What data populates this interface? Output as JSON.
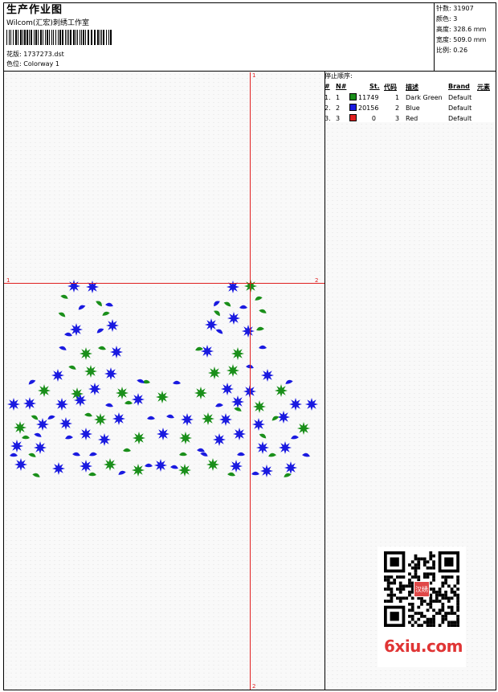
{
  "header": {
    "title": "生产作业图",
    "company": "Wilcom(汇宏)刺绣工作室",
    "pattern_label": "花版:",
    "pattern_value": "1737273.dst",
    "colorway_label": "色位:",
    "colorway_value": "Colorway 1"
  },
  "stats": [
    {
      "label": "针数:",
      "value": "31907"
    },
    {
      "label": "颜色:",
      "value": "3"
    },
    {
      "label": "高度:",
      "value": "328.6 mm"
    },
    {
      "label": "宽度:",
      "value": "509.0 mm"
    },
    {
      "label": "比例:",
      "value": "0.26"
    }
  ],
  "stop_sequence": {
    "title": "停止顺序:",
    "columns": [
      "#",
      "N#",
      "St.",
      "代码",
      "描述",
      "Brand",
      "元素"
    ],
    "rows": [
      {
        "num": "1.",
        "n": "1",
        "stitches": "11749",
        "code": "1",
        "desc": "Dark Green",
        "brand": "Default",
        "color": "#1a8f1a"
      },
      {
        "num": "2.",
        "n": "2",
        "stitches": "20156",
        "code": "2",
        "desc": "Blue",
        "brand": "Default",
        "color": "#1a1ae0"
      },
      {
        "num": "3.",
        "n": "3",
        "stitches": "0",
        "code": "3",
        "desc": "Red",
        "brand": "Default",
        "color": "#e02020"
      }
    ]
  },
  "guides": {
    "h_left": "1",
    "h_right": "2",
    "v_top": "1",
    "v_bottom": "2"
  },
  "watermark": {
    "site": "6xiu.com",
    "stamp_text": "汉绣"
  },
  "colors": {
    "green": "#1a8f1a",
    "blue": "#1a1ae0",
    "guide_red": "#e02020"
  }
}
